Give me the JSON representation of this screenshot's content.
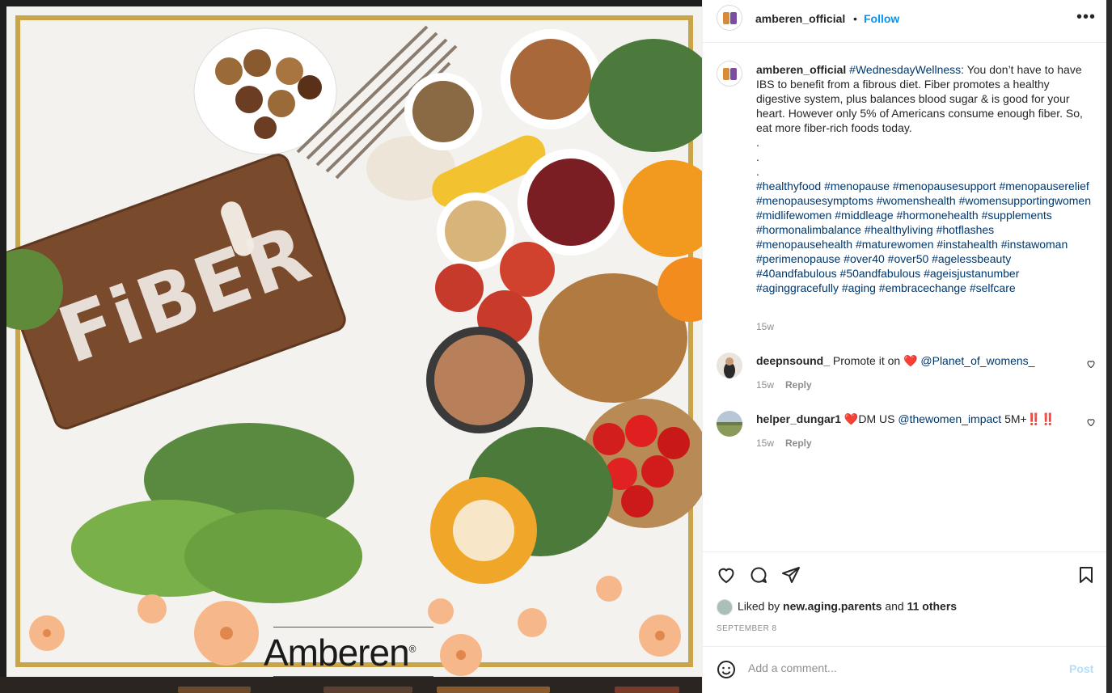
{
  "image": {
    "board_text": "FiBER",
    "brand_text": "Amberen",
    "brand_mark": "®"
  },
  "header": {
    "username": "amberen_official",
    "separator": "•",
    "follow_label": "Follow",
    "more_icon": "more-horizontal-icon"
  },
  "caption": {
    "username": "amberen_official",
    "hashtag_lead": "#WednesdayWellness",
    "body": ": You don’t have to have IBS to benefit from a fibrous diet. Fiber promotes a healthy digestive system, plus balances blood sugar & is good for your heart. However only 5% of Americans consume enough fiber. So, eat more fiber-rich foods today.",
    "dots": [
      ".",
      ".",
      "."
    ],
    "hashtags": "#healthyfood #menopause #menopausesupport #menopauserelief #menopausesymptoms #womenshealth #womensupportingwomen #midlifewomen #middleage #hormonehealth #supplements #hormonalimbalance #healthyliving #hotflashes #menopausehealth #maturewomen #instahealth #instawoman #perimenopause #over40 #over50 #agelessbeauty #40andfabulous #50andfabulous #ageisjustanumber #aginggracefully #aging #embracechange #selfcare",
    "time": "15w"
  },
  "comments": [
    {
      "username": "deepnsound_",
      "text_before": " Promote it on ",
      "emoji": "❤️",
      "mention": "@Planet_of_womens_",
      "text_after": "",
      "time": "15w",
      "reply_label": "Reply"
    },
    {
      "username": "helper_dungar1",
      "text_before": " ",
      "emoji": "❤️",
      "mid_text": "DM US ",
      "mention": "@thewomen_impact",
      "text_after": " 5M+",
      "emoji_after": "‼️‼️",
      "time": "15w",
      "reply_label": "Reply"
    }
  ],
  "actions": {
    "like_icon": "heart-icon",
    "comment_icon": "comment-icon",
    "share_icon": "send-icon",
    "save_icon": "bookmark-icon"
  },
  "likes": {
    "prefix": "Liked by ",
    "user": "new.aging.parents",
    "middle": " and ",
    "others": "11 others"
  },
  "date": "SEPTEMBER 8",
  "add_comment": {
    "placeholder": "Add a comment...",
    "post_label": "Post"
  },
  "colors": {
    "link_blue": "#0095f6",
    "hashtag": "#00376b",
    "muted": "#8e8e8e",
    "post_disabled": "#b2dffc"
  }
}
